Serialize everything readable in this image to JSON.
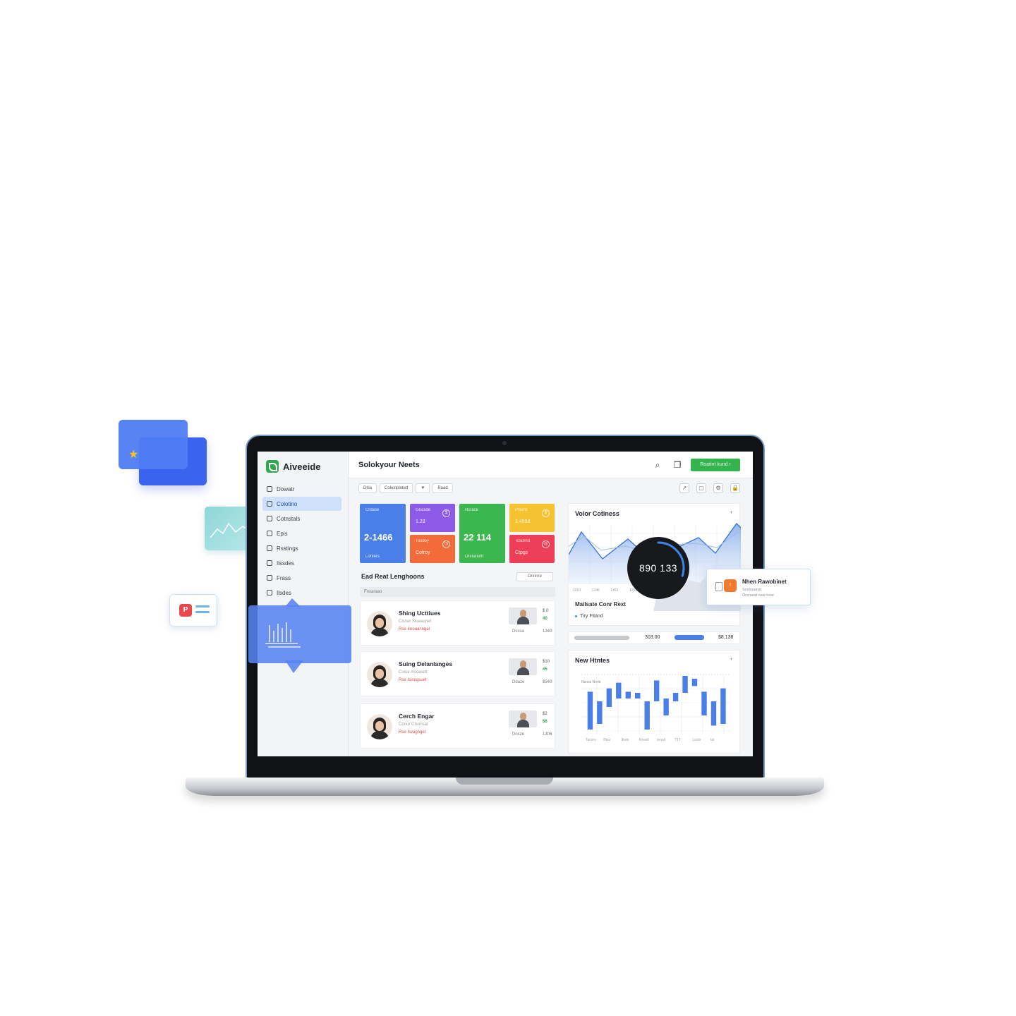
{
  "app": {
    "brand": "Aiveeide",
    "page_title": "Solokyour Neets",
    "cta": "Roatint kund r"
  },
  "sidebar": {
    "items": [
      {
        "label": "Dowatr",
        "icon": "grid-icon"
      },
      {
        "label": "Colotino",
        "icon": "layers-icon",
        "active": true
      },
      {
        "label": "Cotnstals",
        "icon": "person-icon"
      },
      {
        "label": "Epis",
        "icon": "card-icon"
      },
      {
        "label": "Rsstings",
        "icon": "table-icon"
      },
      {
        "label": "Iissdes",
        "icon": "list-icon"
      },
      {
        "label": "Frass",
        "icon": "home-icon"
      },
      {
        "label": "Ilsdes",
        "icon": "settings-icon"
      }
    ]
  },
  "toolbar": {
    "filters": [
      "Ditia",
      "Coleinploted",
      "▼",
      "Raad"
    ],
    "tools": [
      "export-icon",
      "copy-icon",
      "settings-icon",
      "lock-icon"
    ]
  },
  "tiles": [
    {
      "label": "Crdase",
      "value": "2-1466",
      "sub": "Lohfers",
      "color": "#4a7fe8"
    },
    {
      "label": "Goasde",
      "small": "1.28",
      "color": "#8e5be8"
    },
    {
      "label": "Rsrace",
      "value": "22 114",
      "sub": "Onnanoftr",
      "color": "#3cb64f"
    },
    {
      "label": "Ptsvrd",
      "small": "1.4598",
      "color": "#f6c230"
    },
    {
      "label": "Tosdoy",
      "small": "Cotroy",
      "color": "#f26b3a"
    },
    {
      "label": "Tcsdrnd",
      "small": "Ctpgs",
      "color": "#ee3f58"
    }
  ],
  "list": {
    "title": "Ead Reat Lenghoons",
    "button": "Dnnnre",
    "header": "Fnsaraao",
    "cards": [
      {
        "name": "Shing Ucttiues",
        "sub": "Cisnar Siuaaunet",
        "meta": "Rse Iorouanngat",
        "v1": "$ 0",
        "v2": "40",
        "v3": "1340",
        "foot": "Dsssa"
      },
      {
        "name": "Suing Delanlanges",
        "sub": "Coisa #Soasett",
        "meta": "Rse Isinngsuet",
        "v1": "$10",
        "v2": "#5",
        "v3": "$340",
        "foot": "Ddaze"
      },
      {
        "name": "Cerch Engar",
        "sub": "Conor Ctsonsat",
        "meta": "Rse Isvagnget",
        "v1": "$2",
        "v2": "$8",
        "v3": "1306",
        "foot": "Dnsze"
      }
    ]
  },
  "panel_area": {
    "title": "Volor Cotiness",
    "gauge_value": "890 133",
    "gauge_fraction": 0.3,
    "sub_title": "Mailsate Conr Rext",
    "sub_item": "Tiry Fitand",
    "x_ticks": [
      "1310",
      "1346",
      "1452",
      "1350",
      "1500",
      "1420",
      "1300",
      "1330",
      "1500"
    ]
  },
  "stat_row": {
    "value1": "303.00",
    "value2": "$8.138"
  },
  "panel_bars": {
    "title": "New Htntes",
    "legend": "Nsnus   Nnrle",
    "x_ticks": [
      "Tacery",
      "Riss",
      "Itnds",
      "Rosell",
      "Iensd",
      "T1T",
      "Lsots",
      "Ial"
    ],
    "bars": [
      {
        "top": 0.72,
        "bottom": 0.05
      },
      {
        "top": 0.55,
        "bottom": 0.15
      },
      {
        "top": 0.78,
        "bottom": 0.45
      },
      {
        "top": 0.88,
        "bottom": 0.6
      },
      {
        "top": 0.72,
        "bottom": 0.6
      },
      {
        "top": 0.7,
        "bottom": 0.6
      },
      {
        "top": 0.55,
        "bottom": 0.05
      },
      {
        "top": 0.92,
        "bottom": 0.55
      },
      {
        "top": 0.6,
        "bottom": 0.3
      },
      {
        "top": 0.7,
        "bottom": 0.55
      },
      {
        "top": 1.0,
        "bottom": 0.7
      },
      {
        "top": 0.95,
        "bottom": 0.82
      },
      {
        "top": 0.72,
        "bottom": 0.3
      },
      {
        "top": 0.55,
        "bottom": 0.12
      },
      {
        "top": 0.78,
        "bottom": 0.15
      }
    ]
  },
  "notification": {
    "title": "Nhen Rawobinet",
    "sub": "Sostsoanst",
    "sub2": "Orsnand naw tone",
    "badge": "!"
  },
  "decor": {
    "chat_icon_letter": "P"
  }
}
